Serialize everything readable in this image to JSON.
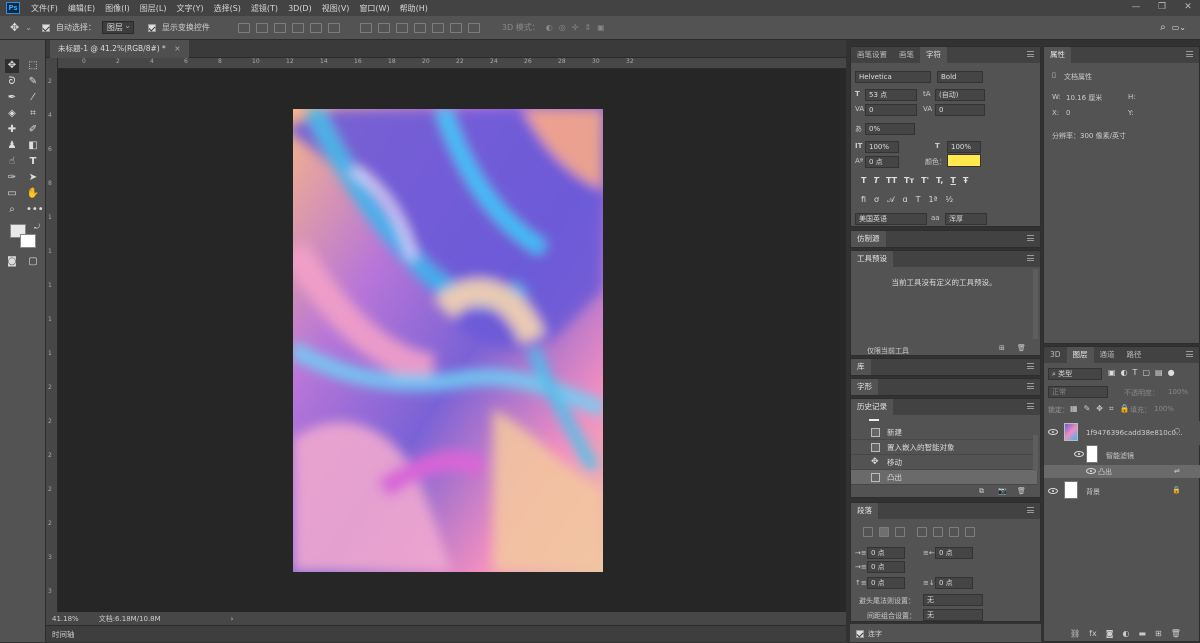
{
  "app": {
    "logo": "Ps"
  },
  "menu": [
    "文件(F)",
    "编辑(E)",
    "图像(I)",
    "图层(L)",
    "文字(Y)",
    "选择(S)",
    "滤镜(T)",
    "3D(D)",
    "视图(V)",
    "窗口(W)",
    "帮助(H)"
  ],
  "options": {
    "auto_select_label": "自动选择：",
    "auto_select_value": "图层",
    "show_transform_label": "显示变换控件",
    "mode_3d": "3D 模式："
  },
  "document": {
    "tab_title": "未标题-1 @ 41.2%(RGB/8#) *",
    "zoom": "41.18%",
    "doc_size": "文档:6.18M/10.8M",
    "timeline": "时间轴"
  },
  "ruler_h": [
    "0",
    "2",
    "4",
    "6",
    "8",
    "10",
    "12",
    "14",
    "16",
    "18",
    "20",
    "22",
    "24",
    "26",
    "28",
    "30",
    "32"
  ],
  "ruler_v": [
    "2",
    "4",
    "6",
    "8",
    "1",
    "1",
    "1",
    "1",
    "1",
    "2",
    "2",
    "2",
    "2",
    "2",
    "3",
    "3"
  ],
  "char_panel": {
    "tabs": [
      "画笔设置",
      "画笔",
      "字符"
    ],
    "font_family": "Helvetica",
    "font_style": "Bold",
    "font_size": "53 点",
    "leading": "(自动)",
    "kerning": "0",
    "tracking": "0",
    "scale_pct": "0%",
    "vscale": "100%",
    "hscale": "100%",
    "baseline": "0 点",
    "color_label": "颜色：",
    "color": "#ffe94d",
    "styles": [
      "T",
      "T",
      "TT",
      "Tт",
      "T'",
      "T,",
      "T",
      "Ŧ"
    ],
    "language": "美国英语",
    "aa_glyph": "aa",
    "aa": "浑厚"
  },
  "clone_panel": {
    "title": "仿制源"
  },
  "tool_presets": {
    "title": "工具预设",
    "empty": "当前工具没有定义的工具预设。",
    "only_current": "仅限当前工具"
  },
  "library": {
    "title": "库"
  },
  "glyphs": {
    "title": "字形"
  },
  "history": {
    "title": "历史记录",
    "rows": [
      "新建",
      "置入嵌入的智能对象",
      "移动",
      "凸出"
    ]
  },
  "paragraph": {
    "title": "段落",
    "indent_left": "0 点",
    "indent_right": "0 点",
    "first_line": "0 点",
    "space_before": "0 点",
    "space_after": "0 点",
    "avoid_label": "避头尾法则设置：",
    "avoid_value": "无",
    "compose_label": "间距组合设置：",
    "compose_value": "无",
    "hyphen_label": "连字"
  },
  "properties": {
    "title": "属性",
    "sub": "文档属性",
    "w_label": "W:",
    "w_value": "10.16 厘米",
    "h_label": "H:",
    "x_label": "X:",
    "x_value": "0",
    "y_label": "Y:",
    "resolution": "分辨率：300 像素/英寸"
  },
  "layers": {
    "tabs": [
      "3D",
      "图层",
      "通道",
      "路径"
    ],
    "filter": "类型",
    "blend": "正常",
    "opacity_label": "不透明度：",
    "opacity": "100%",
    "lock_label": "锁定：",
    "fill_label": "填充：",
    "fill": "100%",
    "items": [
      {
        "name": "1f9476396cadd38e810c0..."
      },
      {
        "name": "智能滤镜"
      },
      {
        "name": "凸出"
      },
      {
        "name": "背景"
      }
    ]
  }
}
